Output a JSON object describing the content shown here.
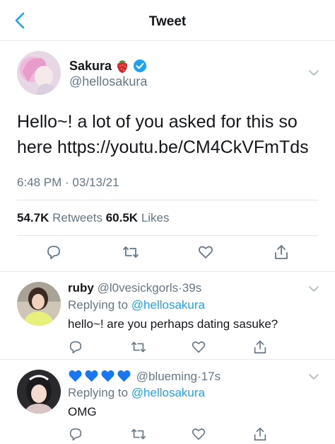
{
  "header": {
    "title": "Tweet"
  },
  "tweet": {
    "name": "Sakura",
    "handle": "@hellosakura",
    "text_line1": "Hello~! a lot of you asked for this so",
    "text_line2": "here https://youtu.be/CM4CkVFmTds",
    "time": "6:48 PM · 03/13/21",
    "retweets": "54.7K",
    "retweets_label": "Retweets",
    "likes": "60.5K",
    "likes_label": "Likes"
  },
  "replies": [
    {
      "name": "ruby",
      "handle": "@l0vesickgorls",
      "dot": "·",
      "time": "39s",
      "replying_prefix": "Replying to",
      "replying_to": "@hellosakura",
      "text": "hello~! are you perhaps dating sasuke?"
    },
    {
      "name": "",
      "handle": "@blueming",
      "dot": "·",
      "time": "17s",
      "replying_prefix": "Replying to",
      "replying_to": "@hellosakura",
      "text": "OMG"
    }
  ],
  "colors": {
    "accent": "#1da1f2",
    "muted": "#657786",
    "text": "#14171a",
    "border": "#e1e8ed"
  }
}
